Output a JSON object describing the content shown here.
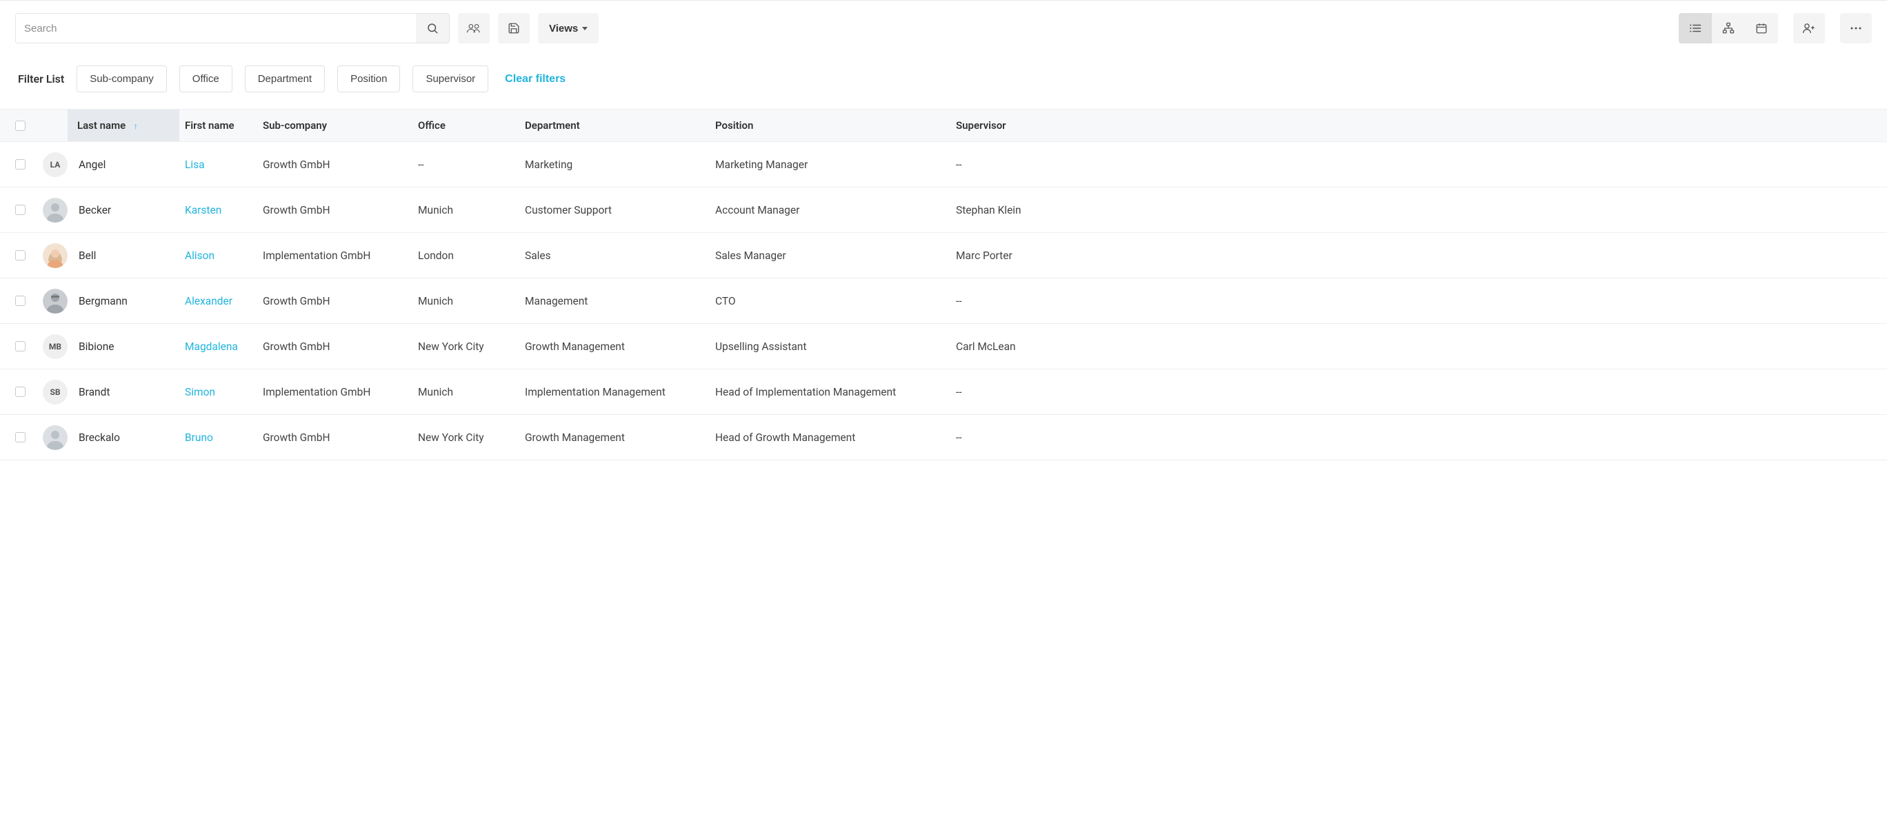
{
  "toolbar": {
    "search_placeholder": "Search",
    "views_label": "Views"
  },
  "filters": {
    "label": "Filter List",
    "chips": [
      "Sub-company",
      "Office",
      "Department",
      "Position",
      "Supervisor"
    ],
    "clear_label": "Clear filters"
  },
  "table": {
    "columns": {
      "lastname": "Last name",
      "firstname": "First name",
      "subcompany": "Sub-company",
      "office": "Office",
      "department": "Department",
      "position": "Position",
      "supervisor": "Supervisor"
    },
    "rows": [
      {
        "initials": "LA",
        "avatar": "initials",
        "lastname": "Angel",
        "firstname": "Lisa",
        "subcompany": "Growth GmbH",
        "office": "--",
        "department": "Marketing",
        "position": "Marketing Manager",
        "supervisor": "--"
      },
      {
        "initials": "",
        "avatar": "photo-m1",
        "lastname": "Becker",
        "firstname": "Karsten",
        "subcompany": "Growth GmbH",
        "office": "Munich",
        "department": "Customer Support",
        "position": "Account Manager",
        "supervisor": "Stephan Klein"
      },
      {
        "initials": "",
        "avatar": "photo-f1",
        "lastname": "Bell",
        "firstname": "Alison",
        "subcompany": "Implementation GmbH",
        "office": "London",
        "department": "Sales",
        "position": "Sales Manager",
        "supervisor": "Marc Porter"
      },
      {
        "initials": "",
        "avatar": "photo-m2",
        "lastname": "Bergmann",
        "firstname": "Alexander",
        "subcompany": "Growth GmbH",
        "office": "Munich",
        "department": "Management",
        "position": "CTO",
        "supervisor": "--"
      },
      {
        "initials": "MB",
        "avatar": "initials",
        "lastname": "Bibione",
        "firstname": "Magdalena",
        "subcompany": "Growth GmbH",
        "office": "New York City",
        "department": "Growth Management",
        "position": "Upselling Assistant",
        "supervisor": "Carl McLean"
      },
      {
        "initials": "SB",
        "avatar": "initials",
        "lastname": "Brandt",
        "firstname": "Simon",
        "subcompany": "Implementation GmbH",
        "office": "Munich",
        "department": "Implementation Management",
        "position": "Head of Implementation Management",
        "supervisor": "--"
      },
      {
        "initials": "",
        "avatar": "photo-m3",
        "lastname": "Breckalo",
        "firstname": "Bruno",
        "subcompany": "Growth GmbH",
        "office": "New York City",
        "department": "Growth Management",
        "position": "Head of Growth Management",
        "supervisor": "--"
      }
    ]
  }
}
